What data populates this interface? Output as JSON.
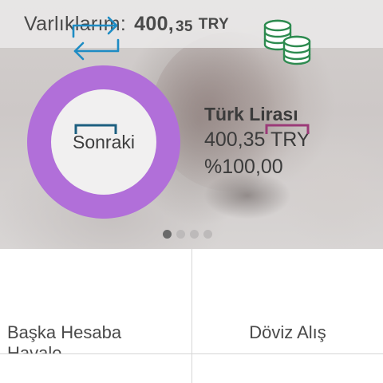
{
  "header": {
    "label": "Varlıklarım:",
    "amount": "400,",
    "amount_decimals": "35",
    "currency": "TRY"
  },
  "donut": {
    "center_label": "Sonraki",
    "color": "#b16fd9",
    "fill_fraction": 1.0
  },
  "asset": {
    "name": "Türk Lirası",
    "amount": "400,35 TRY",
    "percent": "%100,00"
  },
  "pager": {
    "count": 4,
    "active_index": 0
  },
  "actions": [
    {
      "label_line1": "Başka Hesaba",
      "label_line2": "Havale",
      "icon": "transfer-arrows-icon",
      "color": "#1e8cc4"
    },
    {
      "label_line1": "Döviz Alış",
      "icon": "coins-stack-icon",
      "color": "#2e8b50"
    },
    {
      "icon": "document-icon",
      "color": "#1d5f80"
    },
    {
      "icon": "document-icon",
      "color": "#9b3a78"
    }
  ]
}
